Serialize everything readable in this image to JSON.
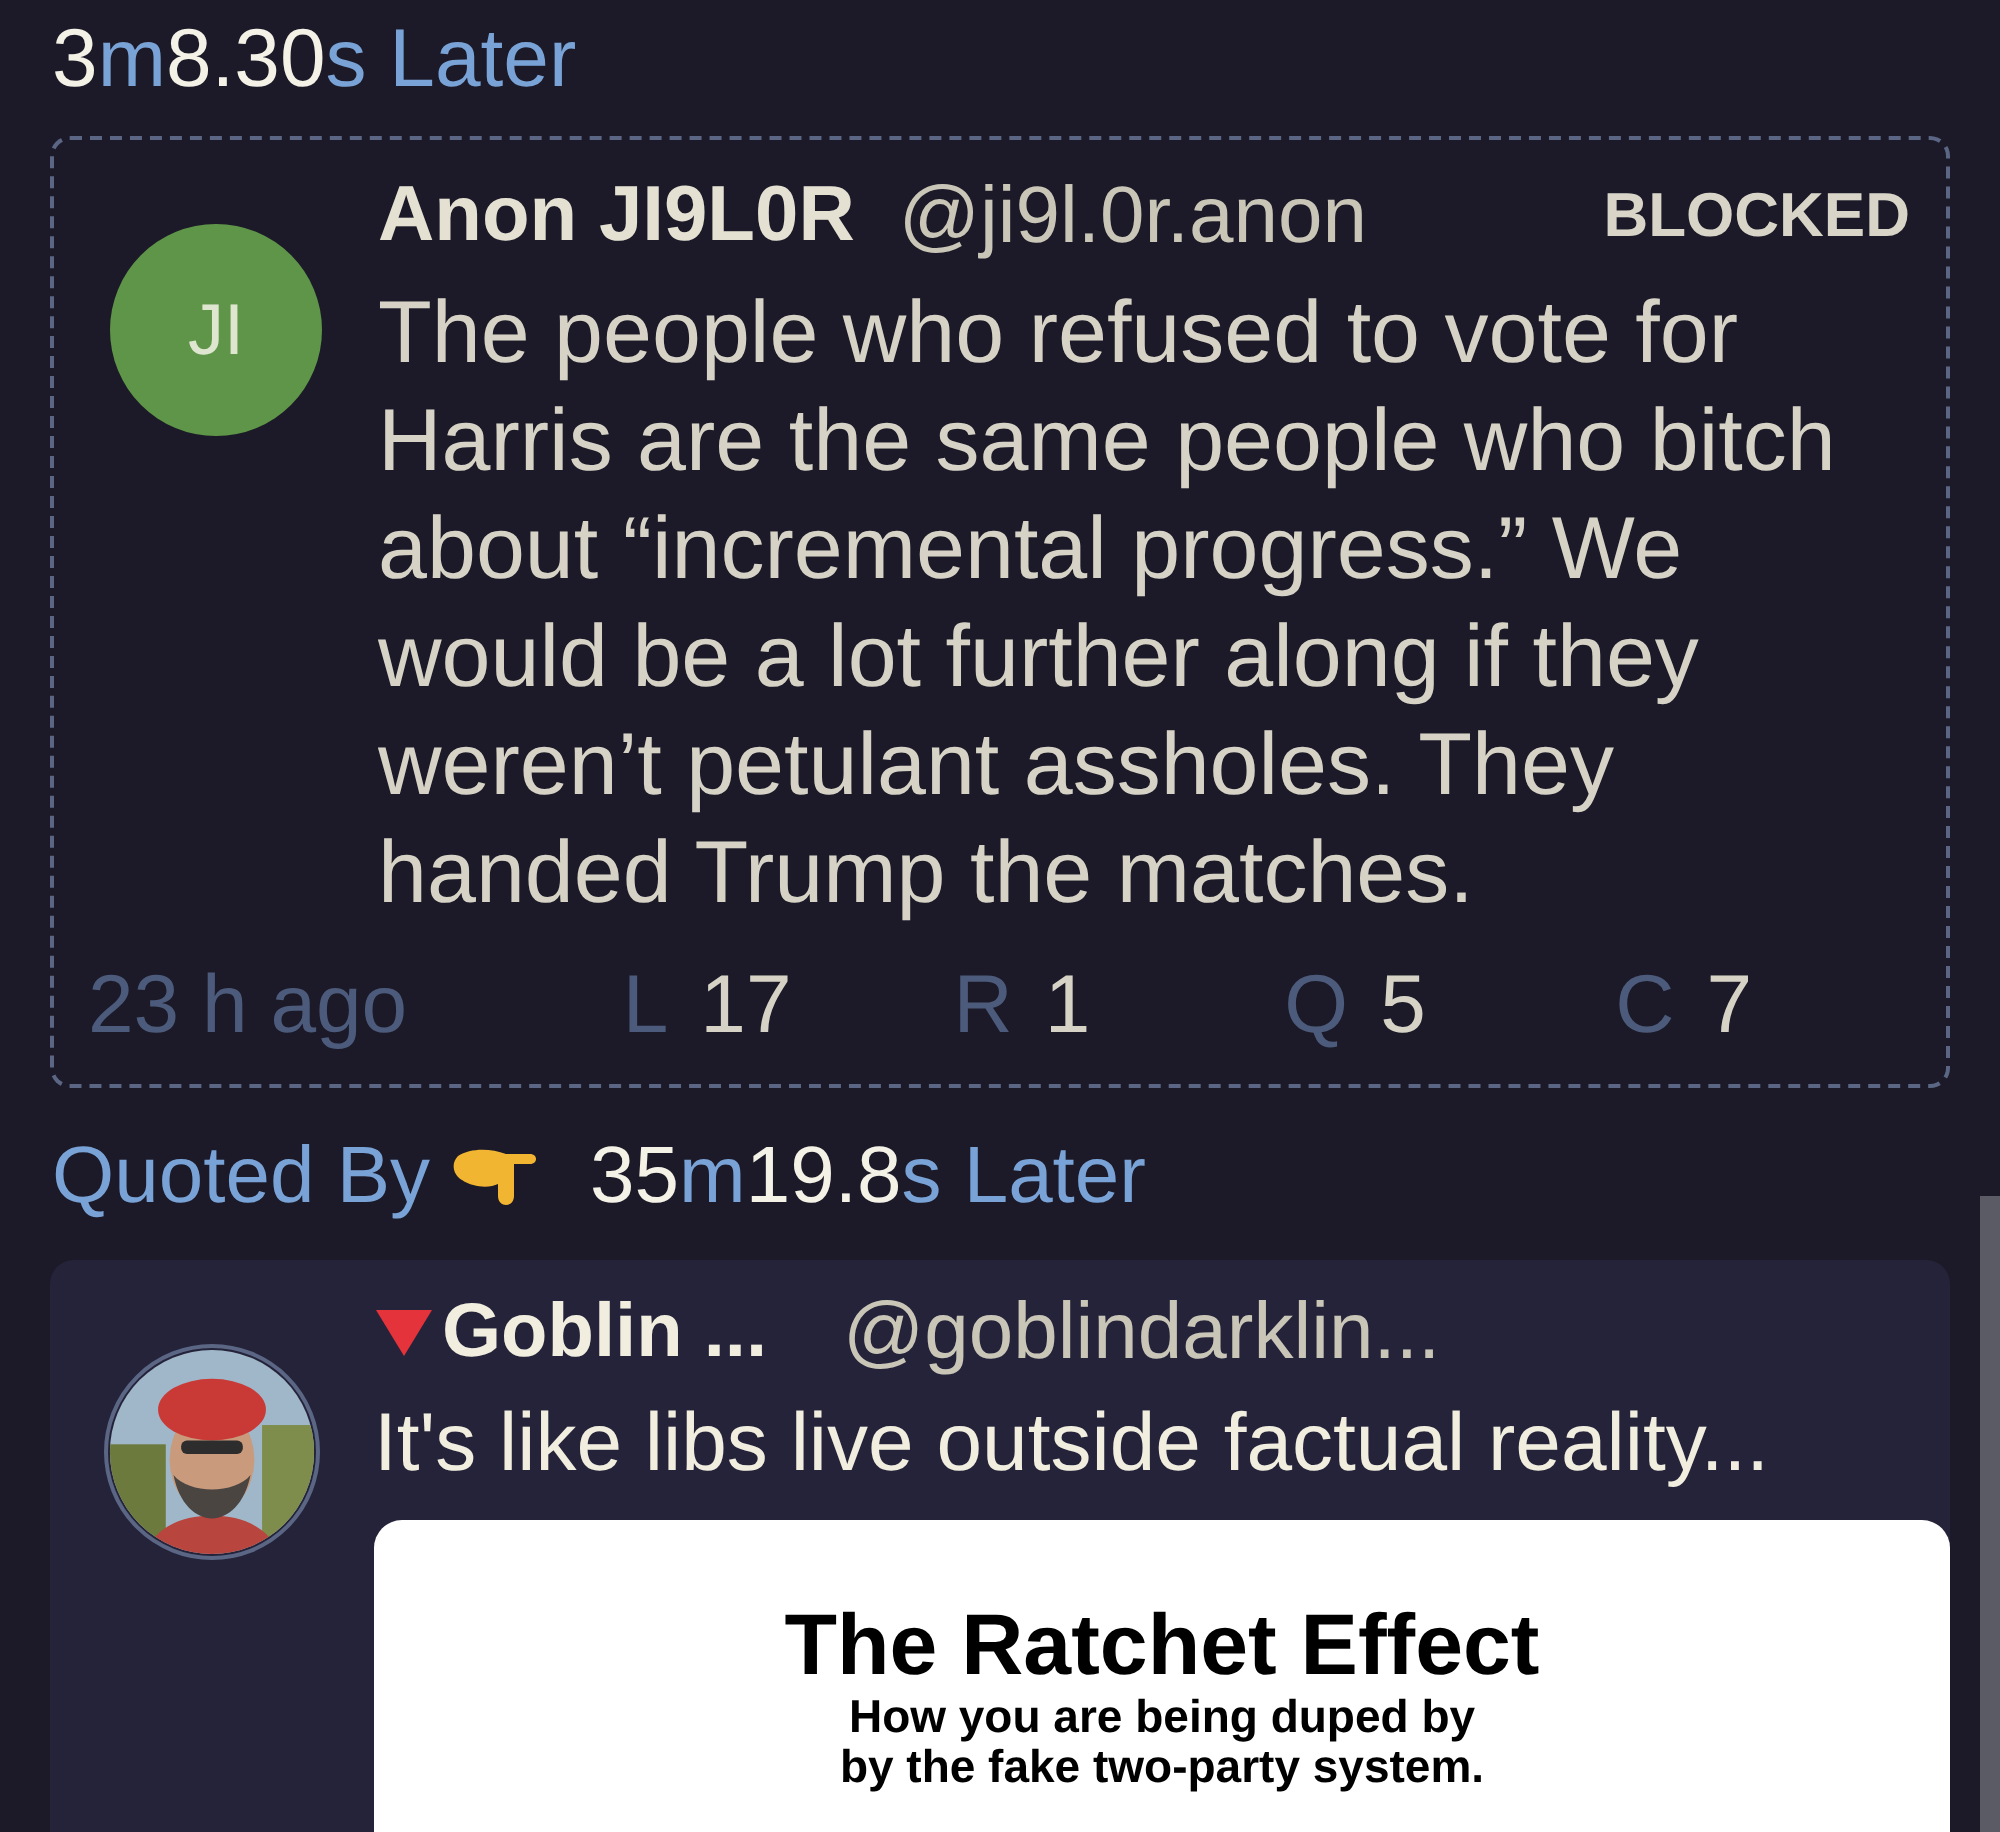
{
  "top_delay": [
    {
      "text": "3",
      "kind": "num"
    },
    {
      "text": "m",
      "kind": "unit"
    },
    {
      "text": "8.30",
      "kind": "num"
    },
    {
      "text": "s Later",
      "kind": "unit"
    }
  ],
  "post": {
    "avatar_initials": "JI",
    "name": "Anon JI9L0R",
    "handle": "@ji9l.0r.anon",
    "status": "BLOCKED",
    "text": "The people who refused to vote for Harris are the same people who bitch about “incremental progress.” We would be a lot further along if they weren’t petulant assholes. They handed Trump the matches.",
    "time": "23 h ago",
    "stats": [
      {
        "label": "L",
        "value": "17"
      },
      {
        "label": "R",
        "value": "1"
      },
      {
        "label": "Q",
        "value": "5"
      },
      {
        "label": "C",
        "value": "7"
      }
    ]
  },
  "quoted_by": {
    "label": "Quoted By",
    "delay": [
      {
        "text": "35",
        "kind": "num"
      },
      {
        "text": "m",
        "kind": "unit"
      },
      {
        "text": "19.8",
        "kind": "num"
      },
      {
        "text": "s Later",
        "kind": "unit"
      }
    ]
  },
  "quote": {
    "name": "Goblin ...",
    "handle": "@goblindarklin...",
    "text": "It's like libs live outside factual reality...",
    "embed": {
      "title": "The Ratchet Effect",
      "subtitle": [
        "How you are being duped by",
        "by the fake two-party system."
      ]
    }
  }
}
